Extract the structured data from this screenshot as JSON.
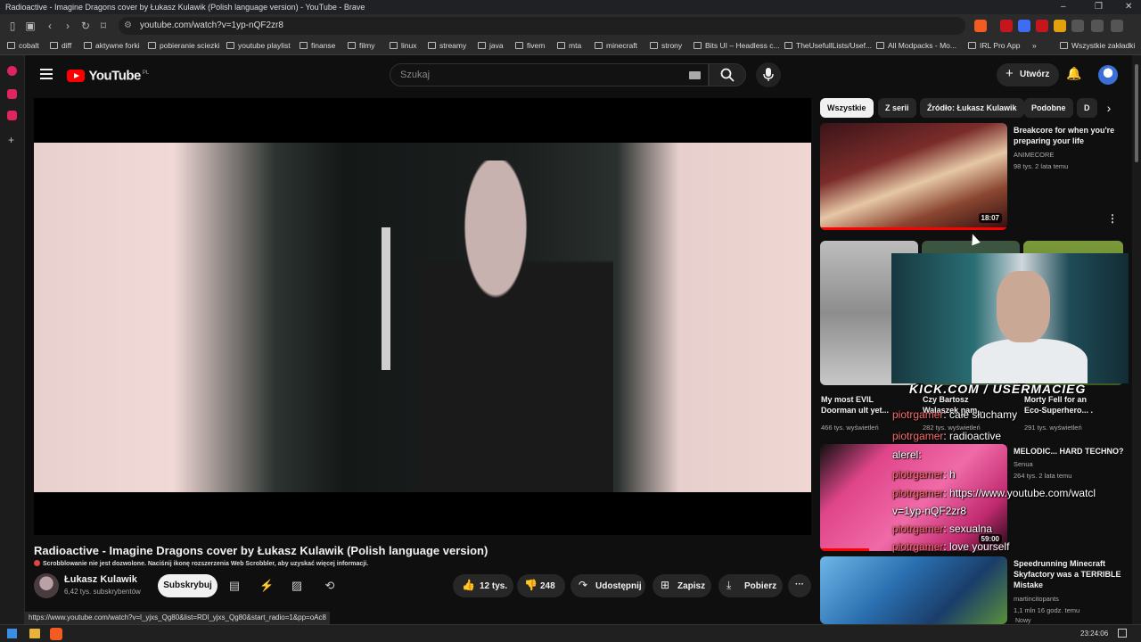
{
  "window": {
    "title": "Radioactive - Imagine Dragons cover by Łukasz Kulawik (Polish language version) - YouTube - Brave",
    "controls": [
      "–",
      "❐",
      "✕"
    ]
  },
  "browser": {
    "url": "youtube.com/watch?v=1yp-nQF2zr8",
    "bookmarks": [
      "cobalt",
      "diff",
      "aktywne forki",
      "pobieranie sciezki",
      "youtube playlist",
      "finanse",
      "filmy",
      "linux",
      "streamy",
      "java",
      "fivem",
      "mta",
      "minecraft",
      "strony",
      "Bits UI – Headless c...",
      "TheUsefullLists/Usef...",
      "All Modpacks - Mo...",
      "IRL Pro App",
      "»",
      "Wszystkie zakładki"
    ],
    "status_url": "https://www.youtube.com/watch?v=l_yjxs_Qg80&list=RDl_yjxs_Qg80&start_radio=1&pp=oAc8"
  },
  "youtube": {
    "logo_text": "YouTube",
    "logo_region": "PL",
    "search_placeholder": "Szukaj",
    "create_label": "Utwórz",
    "video": {
      "title": "Radioactive - Imagine Dragons cover by Łukasz Kulawik (Polish language version)",
      "scrobble_notice": "Scrobblowanie nie jest dozwolone. Naciśnij ikonę rozszerzenia Web Scrobbler, aby uzyskać więcej informacji.",
      "channel_name": "Łukasz Kulawik",
      "channel_subs": "6,42 tys. subskrybentów",
      "subscribe_label": "Subskrybuj",
      "likes": "12 tys.",
      "dislikes": "248",
      "share_label": "Udostępnij",
      "save_label": "Zapisz",
      "download_label": "Pobierz"
    },
    "chips": [
      "Wszystkie",
      "Z serii",
      "Źródło: Łukasz Kulawik",
      "Podobne",
      "D"
    ],
    "recommendations": [
      {
        "title_line1": "Breakcore for when you're",
        "title_line2": "preparing your life",
        "channel": "ANIMECORE",
        "meta": "98 tys.  2 lata temu",
        "duration": "18:07"
      },
      {
        "title": "My most EVIL",
        "title_line2": "Doorman ult yet...",
        "meta": "466 tys. wyświetleń"
      },
      {
        "title": "Czy Bartosz",
        "title_line2": "Walaszek nam...",
        "meta": "282 tys. wyświetleń"
      },
      {
        "title": "Morty Fell for an",
        "title_line2": "Eco-Superhero... .",
        "meta": "291 tys. wyświetleń"
      },
      {
        "title_line1": "MELODIC... HARD TECHNO?",
        "channel": "Senua",
        "meta": "264 tys.  2 lata temu",
        "duration": "59:00"
      },
      {
        "title_line1": "Speedrunning Minecraft",
        "title_line2": "Skyfactory was a TERRIBLE",
        "title_line3": "Mistake",
        "channel": "martincitopants",
        "meta": "1,1 mln  16 godz. temu",
        "badge": "Nowy"
      }
    ]
  },
  "stream_overlay": {
    "kick_handle": "KICK.COM / USERMACIEG",
    "chat": [
      {
        "user": "piotrgamer",
        "msg": "całe słuchamy"
      },
      {
        "user": "piotrgamer",
        "msg": "radioactive"
      },
      {
        "user": "alerel",
        "msg": ""
      },
      {
        "user": "piotrgamer",
        "msg": "h"
      },
      {
        "user": "piotrgamer",
        "msg": "https://www.youtube.com/watcl"
      },
      {
        "user": "",
        "msg": "v=1yp-nQF2zr8"
      },
      {
        "user": "piotrgamer",
        "msg": "sexualna"
      },
      {
        "user": "piotrgamer",
        "msg": "love yourself"
      }
    ]
  },
  "taskbar": {
    "clock": "23:24:06"
  },
  "colors": {
    "background": "#0f0f0f",
    "youtube_red": "#ff0000",
    "chip_active": "#f1f1f1"
  }
}
